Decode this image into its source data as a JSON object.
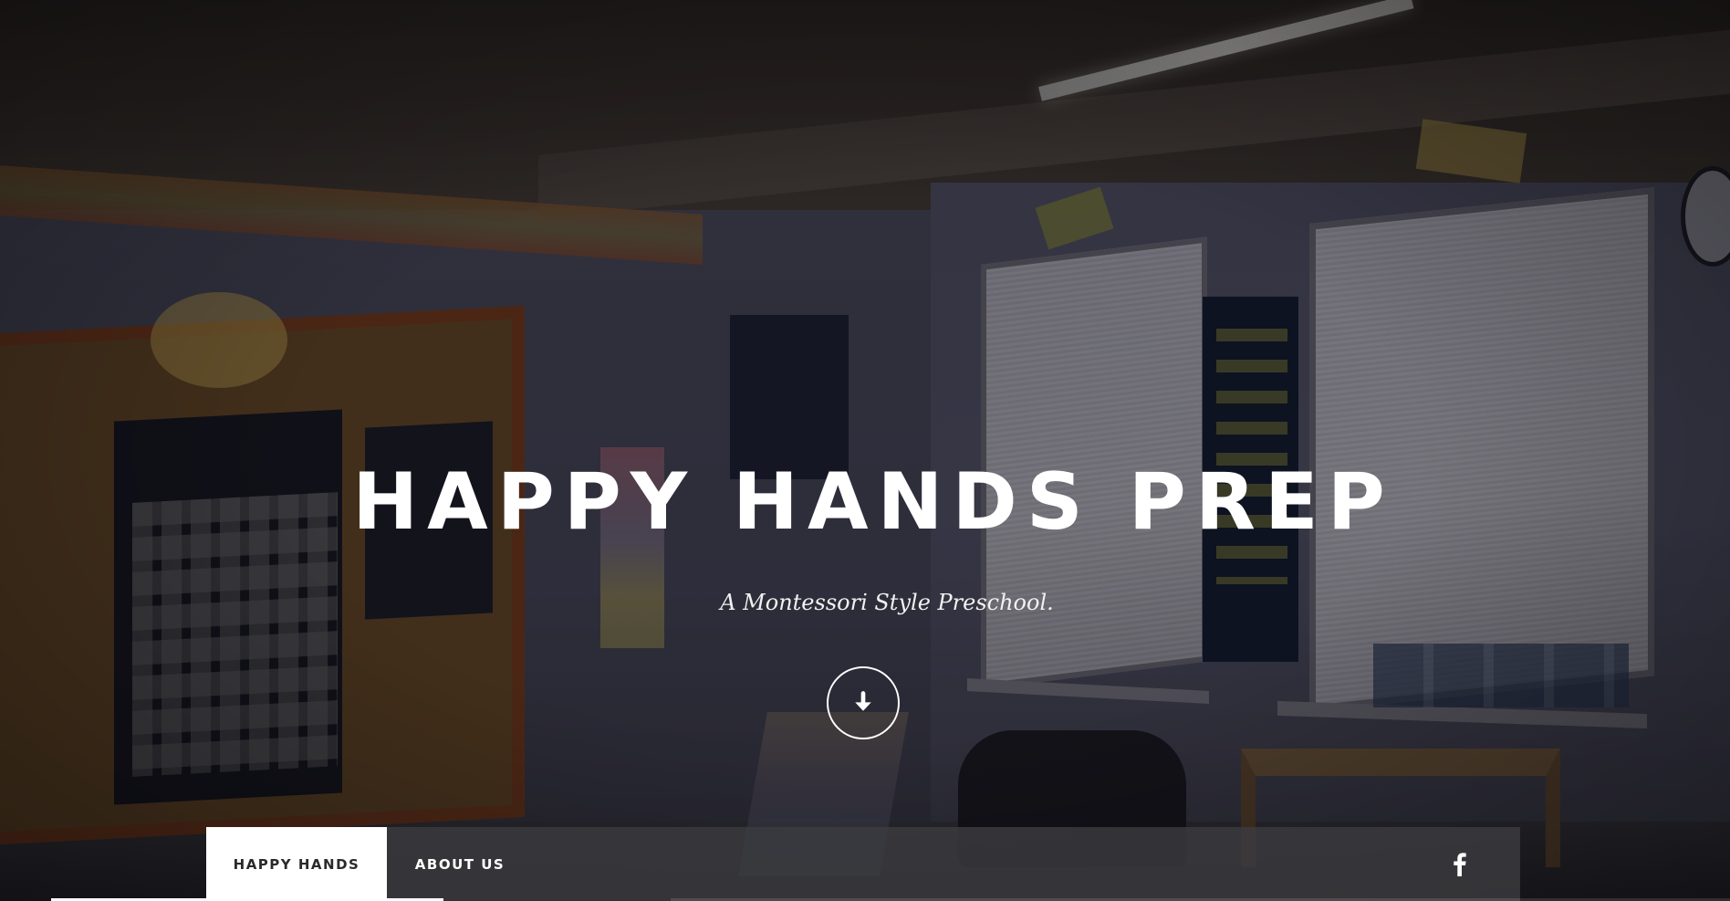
{
  "hero": {
    "title": "HAPPY HANDS PREP",
    "subtitle": "A Montessori Style Preschool.",
    "scroll_icon": "arrow-down-circle-icon"
  },
  "nav": {
    "items": [
      {
        "label": "HAPPY HANDS",
        "active": true
      },
      {
        "label": "ABOUT US",
        "active": false
      }
    ],
    "social_icon": "facebook-icon"
  },
  "colors": {
    "nav_active_bg": "#ffffff",
    "nav_bg": "#3c3c40",
    "text_light": "#ffffff"
  }
}
